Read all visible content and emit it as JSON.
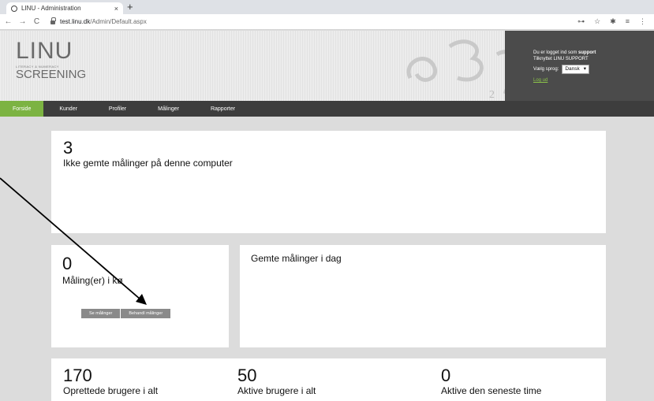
{
  "browser": {
    "tab_title": "LINU - Administration",
    "tab_close": "×",
    "new_tab": "+",
    "url_host": "test.linu.dk",
    "url_path": "/Admin/Default.aspx",
    "nav_back": "←",
    "nav_forward": "→",
    "nav_reload": "C"
  },
  "header": {
    "logo_main": "LINU",
    "logo_tagline": "LITERACY & NUMERACY",
    "logo_sub": "SCREENING",
    "logged_in_prefix": "Du er logget ind som ",
    "logged_in_user": "support",
    "attached_line": "Tilknyttet LINU SUPPORT",
    "language_label": "Vælg sprog:",
    "language_value": "Dansk",
    "logout": "Log ud"
  },
  "nav": {
    "items": [
      "Forside",
      "Kunder",
      "Profiler",
      "Målinger",
      "Rapporter"
    ]
  },
  "panels": {
    "unsaved_count": "3",
    "unsaved_label": "Ikke gemte målinger på denne computer",
    "queue_count": "0",
    "queue_label": "Måling(er) i kø",
    "btn_view": "Se målinger",
    "btn_process": "Behandl målinger",
    "saved_today_label": "Gemte målinger i dag",
    "stats": [
      {
        "value": "170",
        "label": "Oprettede brugere i alt"
      },
      {
        "value": "50",
        "label": "Aktive brugere i alt"
      },
      {
        "value": "0",
        "label": "Aktive den seneste time"
      }
    ]
  },
  "colors": {
    "accent": "#7cb342",
    "nav_bg": "#3d3d3d",
    "page_bg": "#dcdcdc"
  }
}
